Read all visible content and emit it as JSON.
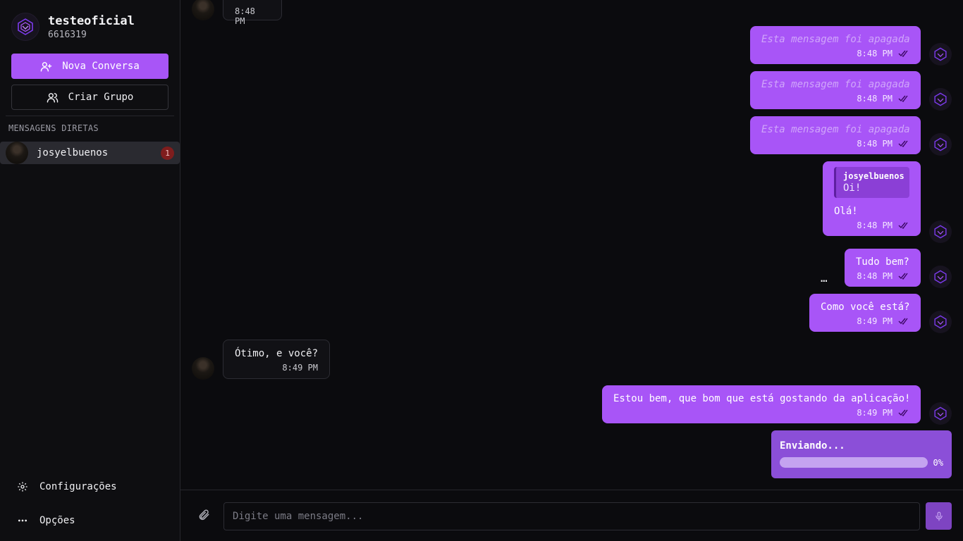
{
  "profile": {
    "name": "testeoficial",
    "id": "6616319"
  },
  "sidebar": {
    "new_chat": "Nova Conversa",
    "create_group": "Criar Grupo",
    "section_title": "MENSAGENS DIRETAS",
    "dms": [
      {
        "name": "josyelbuenos",
        "unread": "1"
      }
    ],
    "settings": "Configurações",
    "options": "Opções"
  },
  "messages": [
    {
      "dir": "in",
      "text": "",
      "time": "8:48 PM"
    },
    {
      "dir": "out",
      "text": "Esta mensagem foi apagada",
      "time": "8:48 PM",
      "deleted": true
    },
    {
      "dir": "out",
      "text": "Esta mensagem foi apagada",
      "time": "8:48 PM",
      "deleted": true
    },
    {
      "dir": "out",
      "text": "Esta mensagem foi apagada",
      "time": "8:48 PM",
      "deleted": true
    },
    {
      "dir": "out",
      "text": "Olá!",
      "time": "8:48 PM",
      "reply": {
        "author": "josyelbuenos",
        "text": "Oi!"
      }
    },
    {
      "dir": "out",
      "text": "Tudo bem?",
      "time": "8:48 PM"
    },
    {
      "dir": "out",
      "text": "Como você está?",
      "time": "8:49 PM"
    },
    {
      "dir": "in",
      "text": "Ótimo, e você?",
      "time": "8:49 PM"
    },
    {
      "dir": "out",
      "text": "Estou bem, que bom que está gostando da aplicação!",
      "time": "8:49 PM"
    }
  ],
  "more_menu": "…",
  "upload": {
    "label": "Enviando...",
    "percent_text": "0%",
    "progress": 0
  },
  "composer": {
    "placeholder": "Digite uma mensagem..."
  },
  "colors": {
    "accent": "#a855f7",
    "background": "#0b0b0e",
    "badge": "#7f1d1d"
  },
  "icons": [
    "logo-icon",
    "user-plus-icon",
    "users-icon",
    "gear-icon",
    "ellipsis-icon",
    "double-check-icon",
    "paperclip-icon",
    "mic-icon"
  ]
}
